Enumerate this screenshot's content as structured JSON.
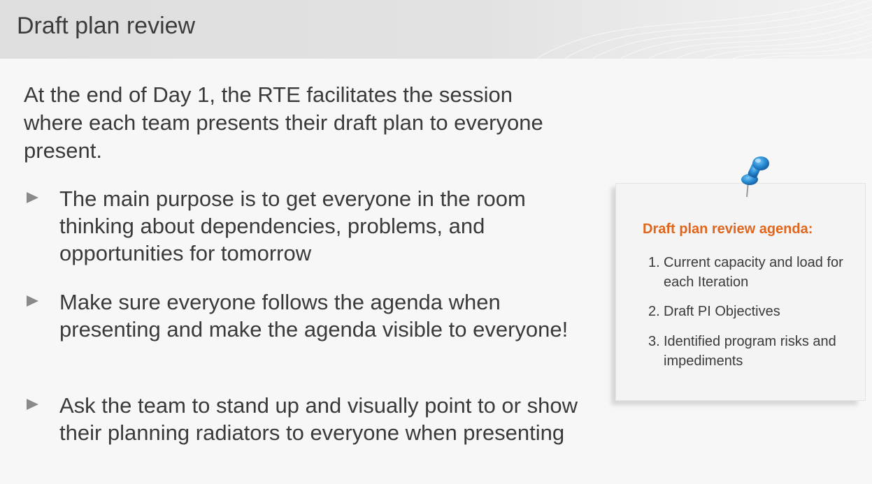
{
  "slide": {
    "title": "Draft plan review",
    "intro": "At the end of Day 1, the RTE facilitates the session where each team presents their draft plan to everyone present.",
    "bullets": [
      {
        "text": "The main purpose is to get everyone in the room thinking about dependencies, problems, and opportunities for tomorrow"
      },
      {
        "text": "Make sure everyone follows the agenda when presenting and make the agenda visible to everyone!"
      },
      {
        "text": "Ask the team to stand up and visually point to or show their planning radiators to everyone when presenting"
      }
    ]
  },
  "note": {
    "title": "Draft plan review agenda:",
    "items": [
      {
        "num": "1.",
        "text": "Current capacity and load for each Iteration"
      },
      {
        "num": "2.",
        "text": "Draft PI Objectives"
      },
      {
        "num": "3.",
        "text": "Identified program risks and impediments"
      }
    ]
  },
  "icons": {
    "bullet_marker": "triangle-right-icon",
    "pin": "pushpin-icon"
  },
  "colors": {
    "accent": "#e0661d",
    "pin": "#2b8fd6",
    "bullet": "#8a8a8a",
    "header_bg": "#e0e0e0"
  }
}
